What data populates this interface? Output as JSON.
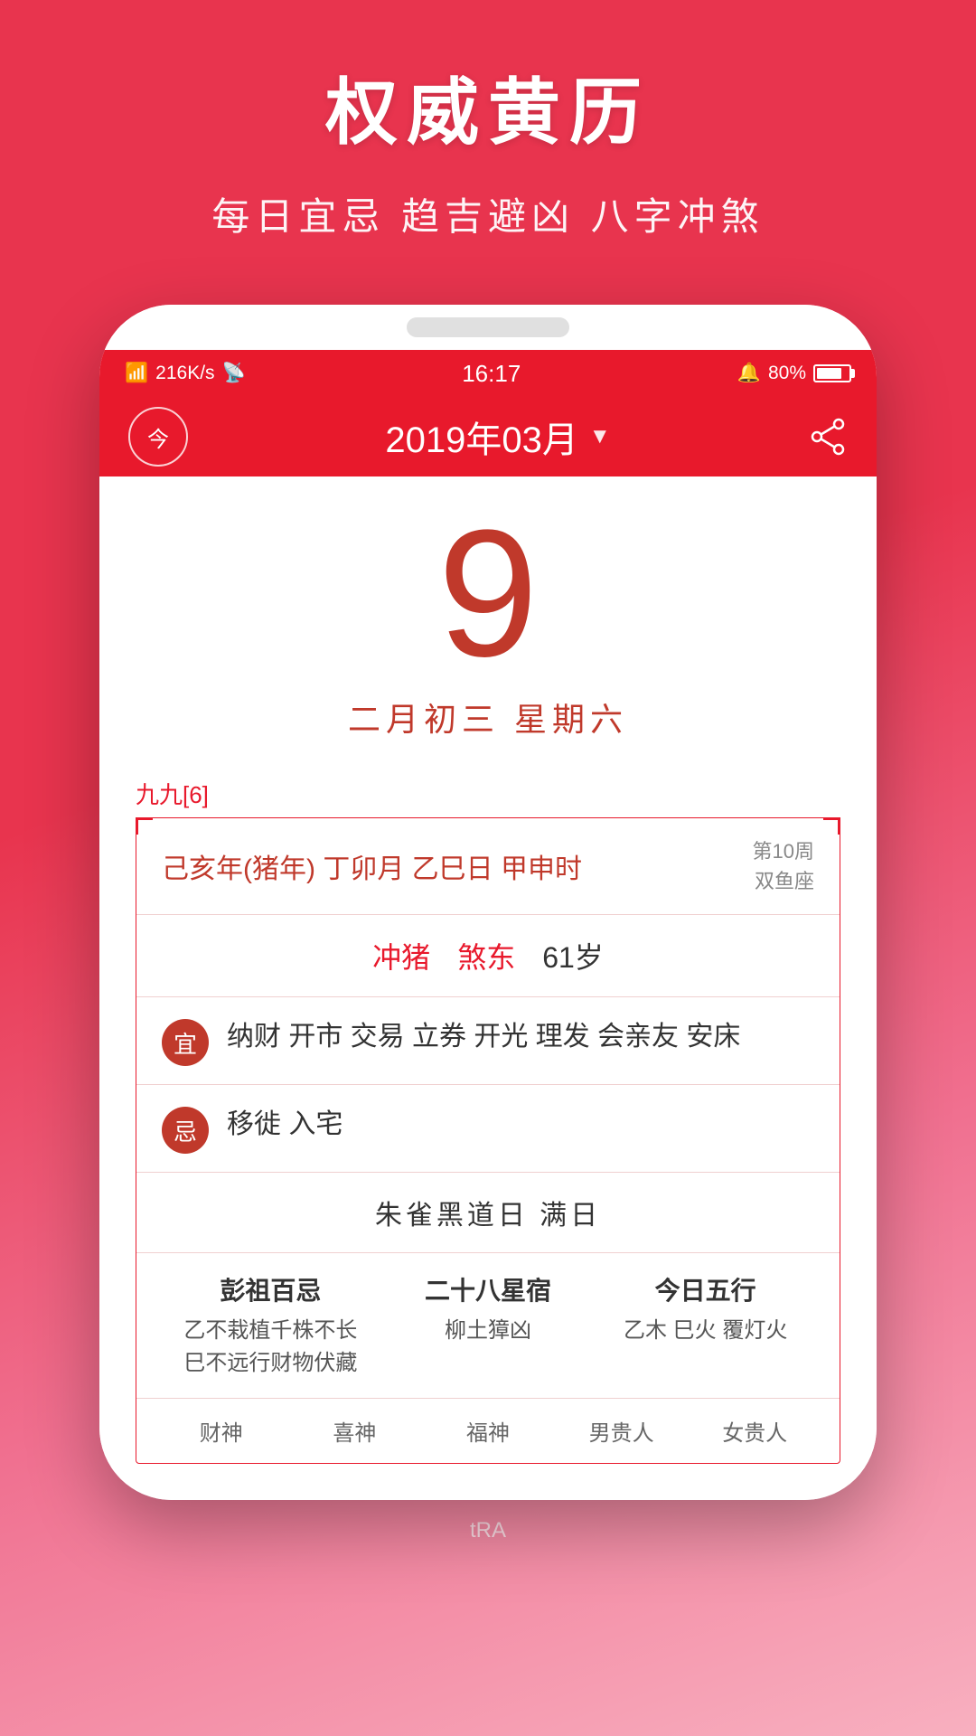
{
  "app": {
    "title": "权威黄历",
    "subtitle": "每日宜忌 趋吉避凶 八字冲煞"
  },
  "status_bar": {
    "signal": "4G",
    "speed": "216K/s",
    "wifi": "WiFi",
    "time": "16:17",
    "alarm": "🔕",
    "battery_percent": "80%"
  },
  "header": {
    "today_label": "今",
    "month_title": "2019年03月",
    "dropdown_arrow": "▼"
  },
  "date": {
    "day": "9",
    "lunar": "二月初三  星期六"
  },
  "nine_nine": "九九[6]",
  "ganzhi": {
    "main": "己亥年(猪年) 丁卯月 乙巳日 甲申时",
    "week": "第10周",
    "zodiac": "双鱼座"
  },
  "chong_sha": {
    "label1": "冲猪",
    "label2": "煞东",
    "age": "61岁"
  },
  "yi": {
    "badge": "宜",
    "content": "纳财 开市 交易 立券 开光 理发 会亲友 安床"
  },
  "ji": {
    "badge": "忌",
    "content": "移徙 入宅"
  },
  "special_day": "朱雀黑道日  满日",
  "info_grid": {
    "col1": {
      "title": "彭祖百忌",
      "line1": "乙不栽植千株不长",
      "line2": "巳不远行财物伏藏"
    },
    "col2": {
      "title": "二十八星宿",
      "content": "柳土獐凶"
    },
    "col3": {
      "title": "今日五行",
      "content": "乙木 巳火 覆灯火"
    }
  },
  "gods": {
    "items": [
      "财神",
      "喜神",
      "福神",
      "男贵人",
      "女贵人"
    ]
  },
  "watermark": "tRA"
}
